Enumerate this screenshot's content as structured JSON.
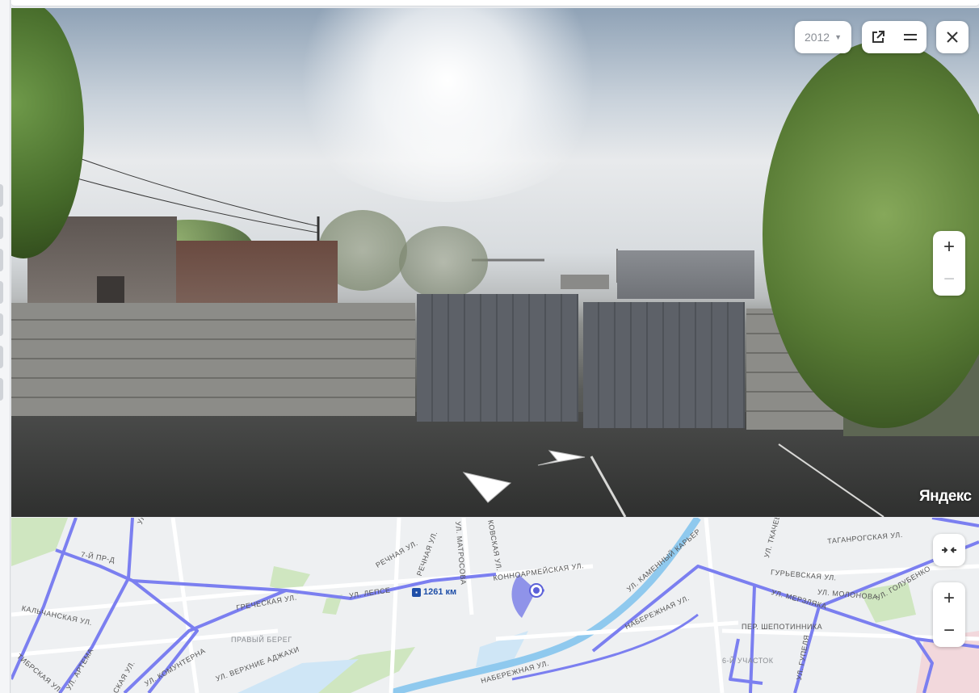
{
  "panorama": {
    "year": "2012",
    "brand": "Яндекс",
    "zoom_in": "+",
    "zoom_out": "−",
    "icons": {
      "year_caret": "triangle-down-icon",
      "external": "external-link-icon",
      "menu": "menu-icon",
      "close": "close-icon"
    }
  },
  "map": {
    "distance_badge": "1261 км",
    "zoom_in": "+",
    "zoom_out": "−",
    "labels": [
      {
        "text": "ул. Макара",
        "rot": -70
      },
      {
        "text": "7-й пр-д",
        "rot": 10
      },
      {
        "text": "Кальчанская ул.",
        "rot": 12
      },
      {
        "text": "Греческая ул.",
        "rot": -10
      },
      {
        "text": "ул. Лепсе",
        "rot": -8
      },
      {
        "text": "Речная ул.",
        "rot": -30
      },
      {
        "text": "Речная ул.",
        "rot": -70
      },
      {
        "text": "ул. Матросова",
        "rot": 85
      },
      {
        "text": "Ковская ул.",
        "rot": 80
      },
      {
        "text": "Конноармейская ул.",
        "rot": -8
      },
      {
        "text": "Правый Берег",
        "rot": 0
      },
      {
        "text": "ул. Комунтерна",
        "rot": -30
      },
      {
        "text": "ул. Верхние Аджахи",
        "rot": -20
      },
      {
        "text": "Тибрская ул.",
        "rot": 40
      },
      {
        "text": "ул. Артема",
        "rot": -60
      },
      {
        "text": "ул. Каменный Карьер",
        "rot": -40
      },
      {
        "text": "Набережная ул.",
        "rot": -25
      },
      {
        "text": "Набережная ул.",
        "rot": -15
      },
      {
        "text": "ул. Ткачева",
        "rot": -75
      },
      {
        "text": "Таганрогская ул.",
        "rot": -5
      },
      {
        "text": "Гурьевская ул.",
        "rot": 5
      },
      {
        "text": "ул. Голубенко",
        "rot": -30
      },
      {
        "text": "ул. Мерзляка",
        "rot": 15
      },
      {
        "text": "ул. Молонова",
        "rot": 5
      },
      {
        "text": "пер. Шепотинника",
        "rot": 0
      },
      {
        "text": "6-й участок",
        "rot": 0
      },
      {
        "text": "ул. Гупеля",
        "rot": -80
      },
      {
        "text": "ская ул.",
        "rot": -60
      }
    ]
  }
}
